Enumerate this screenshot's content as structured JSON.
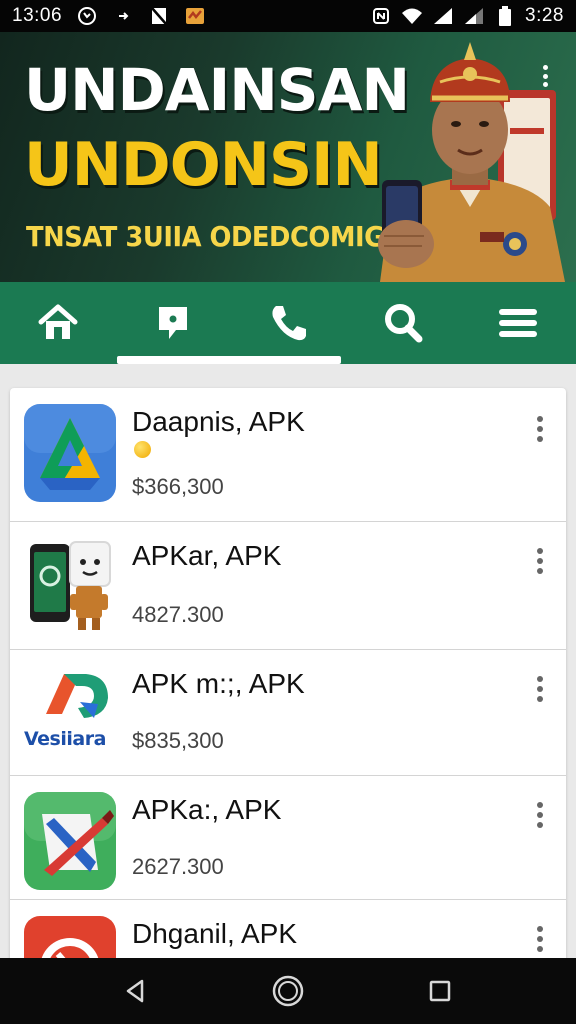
{
  "status_bar": {
    "time_left": "13:06",
    "time_right": "3:28",
    "icons_left": [
      "whatsapp-icon",
      "usb-icon",
      "no-sim-icon",
      "notification-icon"
    ],
    "icons_right": [
      "nfc-icon",
      "wifi-icon",
      "signal-icon",
      "signal-icon",
      "battery-icon"
    ]
  },
  "banner": {
    "title_line1": "UNDAINSAN",
    "title_line2": "UNDONSIN",
    "subtitle": "TNSAT 3UIIA ODEDCOMIGN",
    "colors": {
      "title1": "#ffffff",
      "title2": "#f5c518",
      "subtitle": "#f7d64a",
      "background": "#1f5a40"
    }
  },
  "nav": {
    "tabs": [
      {
        "icon": "home-icon"
      },
      {
        "icon": "chat-icon"
      },
      {
        "icon": "phone-icon"
      },
      {
        "icon": "search-icon"
      },
      {
        "icon": "menu-icon"
      }
    ],
    "selected_index": 1,
    "color": "#1b7a52"
  },
  "apps": [
    {
      "name": "Daapnis, APK",
      "price": "$366,300",
      "icon": "drive-triangle-icon",
      "has_dot": true
    },
    {
      "name": "APKar, APK",
      "price": "4827.300",
      "icon": "phone-robot-icon",
      "has_dot": false
    },
    {
      "name": "APK m:;, APK",
      "price": "$835,300",
      "icon": "vesiiara-logo-icon",
      "icon_text": "Vesiiara",
      "has_dot": false
    },
    {
      "name": "APKa:, APK",
      "price": "2627.300",
      "icon": "pen-app-icon",
      "has_dot": false
    },
    {
      "name": "Dhganil, APK",
      "price": "",
      "icon": "red-compass-icon",
      "has_dot": false
    }
  ],
  "system_nav": [
    "back-icon",
    "home-circle-icon",
    "recents-icon"
  ]
}
